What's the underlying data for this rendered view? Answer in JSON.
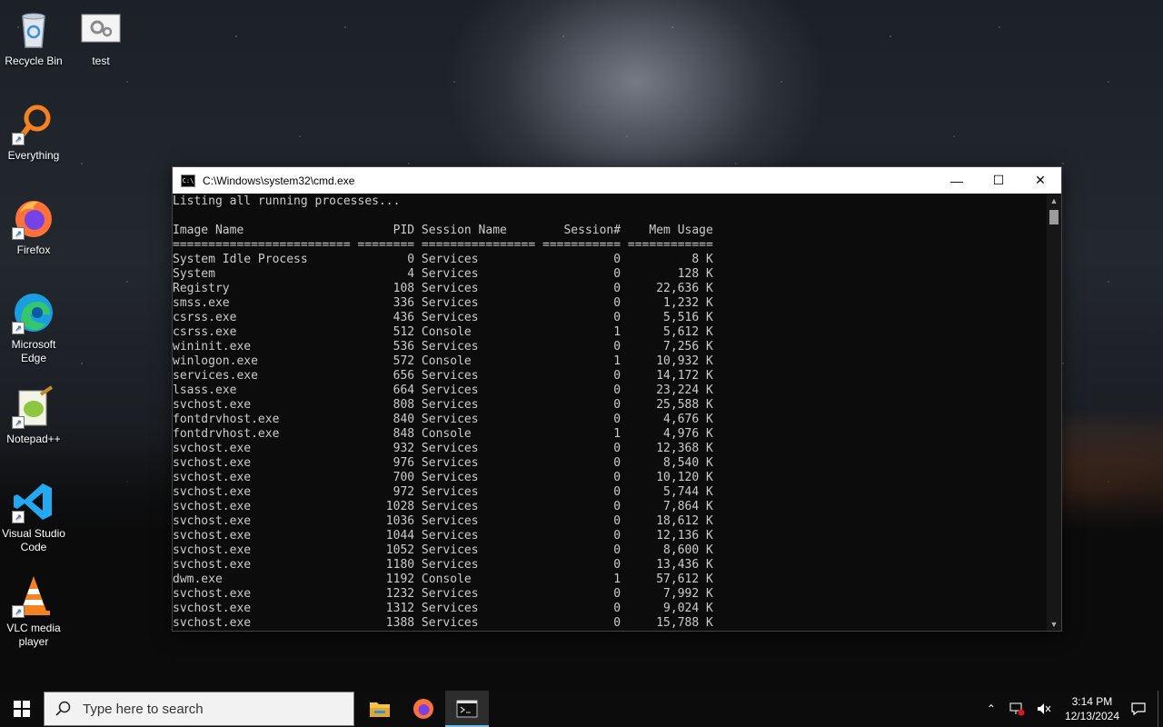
{
  "desktop": {
    "icons": [
      {
        "label": "Recycle Bin"
      },
      {
        "label": "test"
      },
      {
        "label": "Everything"
      },
      {
        "label": "Firefox"
      },
      {
        "label": "Microsoft Edge"
      },
      {
        "label": "Notepad++"
      },
      {
        "label": "Visual Studio Code"
      },
      {
        "label": "VLC media player"
      }
    ]
  },
  "window": {
    "title": "C:\\Windows\\system32\\cmd.exe",
    "icon_text": "C:\\",
    "minimize": "—",
    "maximize": "☐",
    "close": "✕"
  },
  "console": {
    "lines": [
      "Listing all running processes...",
      "",
      "Image Name                     PID Session Name        Session#    Mem Usage",
      "========================= ======== ================ =========== ============",
      "System Idle Process              0 Services                   0          8 K",
      "System                           4 Services                   0        128 K",
      "Registry                       108 Services                   0     22,636 K",
      "smss.exe                       336 Services                   0      1,232 K",
      "csrss.exe                      436 Services                   0      5,516 K",
      "csrss.exe                      512 Console                    1      5,612 K",
      "wininit.exe                    536 Services                   0      7,256 K",
      "winlogon.exe                   572 Console                    1     10,932 K",
      "services.exe                   656 Services                   0     14,172 K",
      "lsass.exe                      664 Services                   0     23,224 K",
      "svchost.exe                    808 Services                   0     25,588 K",
      "fontdrvhost.exe                840 Services                   0      4,676 K",
      "fontdrvhost.exe                848 Console                    1      4,976 K",
      "svchost.exe                    932 Services                   0     12,368 K",
      "svchost.exe                    976 Services                   0      8,540 K",
      "svchost.exe                    700 Services                   0     10,120 K",
      "svchost.exe                    972 Services                   0      5,744 K",
      "svchost.exe                   1028 Services                   0      7,864 K",
      "svchost.exe                   1036 Services                   0     18,612 K",
      "svchost.exe                   1044 Services                   0     12,136 K",
      "svchost.exe                   1052 Services                   0      8,600 K",
      "svchost.exe                   1180 Services                   0     13,436 K",
      "dwm.exe                       1192 Console                    1     57,612 K",
      "svchost.exe                   1232 Services                   0      7,992 K",
      "svchost.exe                   1312 Services                   0      9,024 K",
      "svchost.exe                   1388 Services                   0     15,788 K"
    ]
  },
  "taskbar": {
    "search_placeholder": "Type here to search",
    "apps": [
      "File Explorer",
      "Firefox",
      "Command Prompt"
    ],
    "active_app": "Command Prompt",
    "time": "3:14 PM",
    "date": "12/13/2024",
    "accent": "#76b9ed"
  }
}
